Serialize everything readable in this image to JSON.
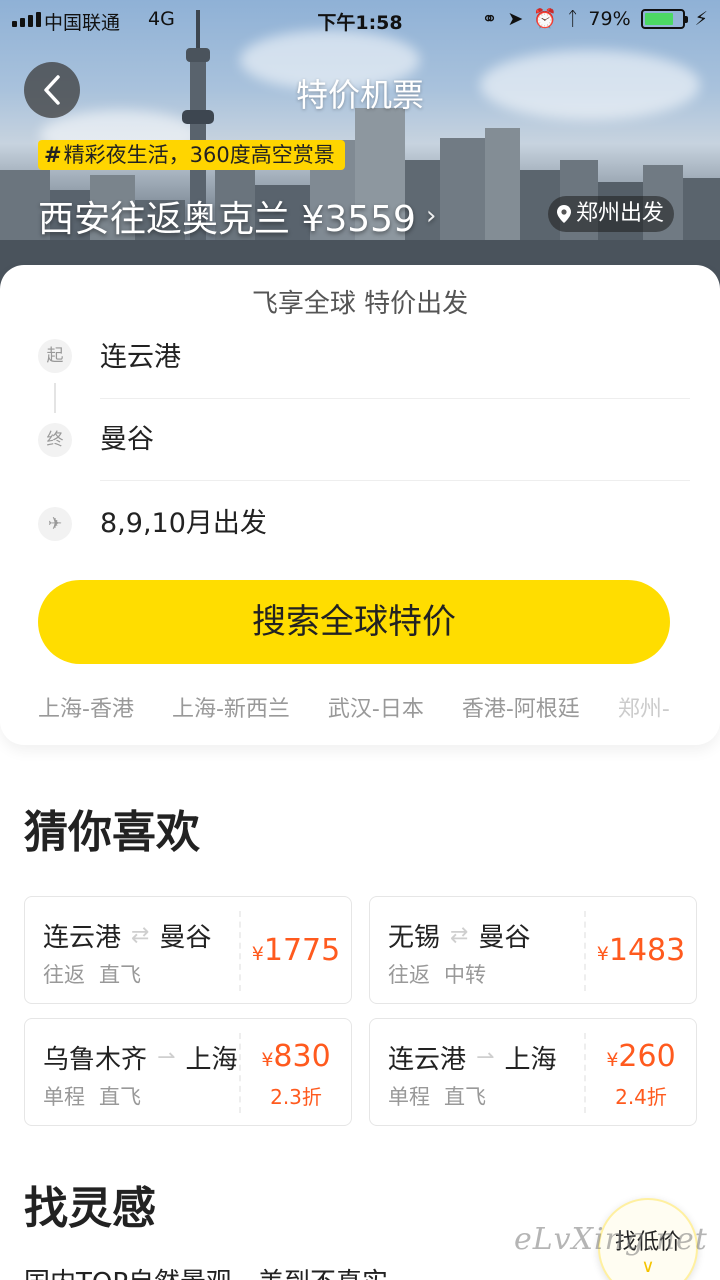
{
  "status_bar": {
    "carrier": "中国联通",
    "network": "4G",
    "time": "下午1:58",
    "battery": "79%",
    "battery_level": 0.79
  },
  "header": {
    "title": "特价机票",
    "promo_tag": "精彩夜生活，360度高空赏景",
    "promo_hash": "#",
    "promo_headline": "西安往返奥克兰 ¥3559",
    "departure_city": "郑州出发"
  },
  "search": {
    "subtitle": "飞享全球 特价出发",
    "origin_badge": "起",
    "origin": "连云港",
    "destination_badge": "终",
    "destination": "曼谷",
    "date": "8,9,10月出发",
    "button_label": "搜索全球特价",
    "quick_routes": [
      "上海-香港",
      "上海-新西兰",
      "武汉-日本",
      "香港-阿根廷",
      "郑州-"
    ]
  },
  "guess_you_like": {
    "title": "猜你喜欢",
    "deals": [
      {
        "from": "连云港",
        "to": "曼谷",
        "trip": "往返",
        "stops": "直飞",
        "currency": "¥",
        "price": "1775",
        "discount": ""
      },
      {
        "from": "无锡",
        "to": "曼谷",
        "trip": "往返",
        "stops": "中转",
        "currency": "¥",
        "price": "1483",
        "discount": ""
      },
      {
        "from": "乌鲁木齐",
        "to": "上海",
        "trip": "单程",
        "stops": "直飞",
        "currency": "¥",
        "price": "830",
        "discount": "2.3折"
      },
      {
        "from": "连云港",
        "to": "上海",
        "trip": "单程",
        "stops": "直飞",
        "currency": "¥",
        "price": "260",
        "discount": "2.4折"
      }
    ]
  },
  "inspiration": {
    "title": "找灵感",
    "first_item": "国内TOP自然景观，美到不真实"
  },
  "floating_button": {
    "label": "找低价"
  },
  "watermark": "eLvXing.net",
  "colors": {
    "accent_yellow": "#ffdd00",
    "price_orange": "#ff5a1e"
  }
}
